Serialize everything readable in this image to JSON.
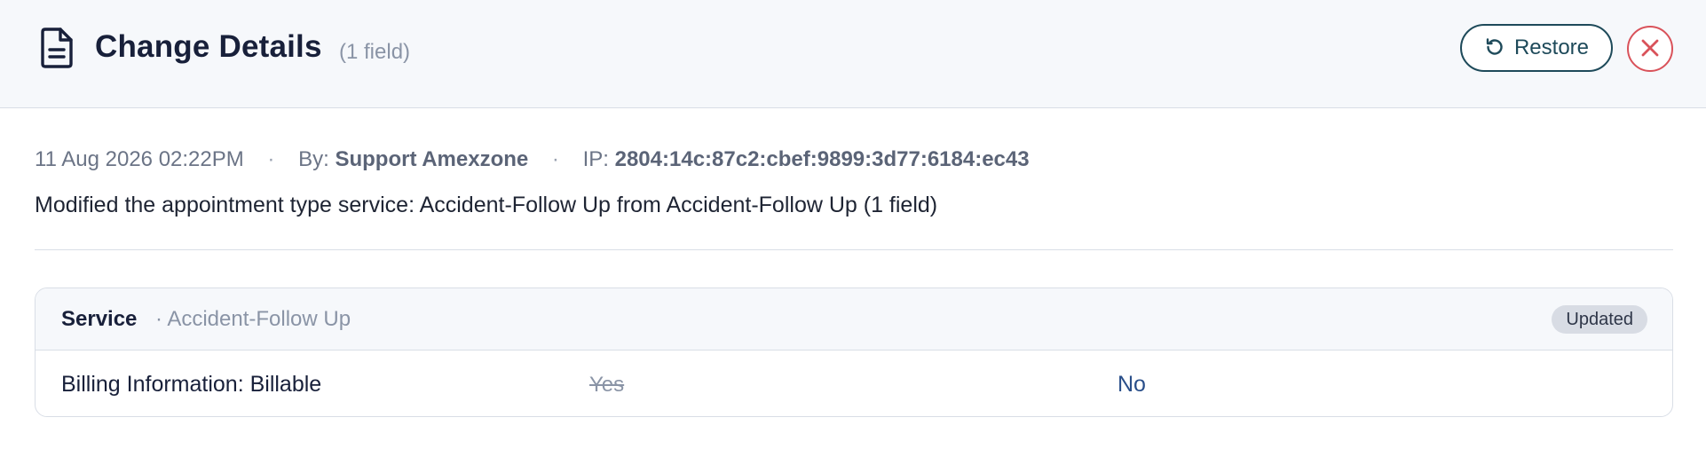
{
  "header": {
    "title": "Change Details",
    "field_count": "(1 field)",
    "restore_label": "Restore",
    "icons": [
      "document-icon",
      "restore-icon",
      "close-icon"
    ]
  },
  "meta": {
    "timestamp": "11 Aug 2026 02:22PM",
    "separator": "·",
    "by_prefix": "By:",
    "by_value": "Support Amexzone",
    "ip_prefix": "IP:",
    "ip_value": "2804:14c:87c2:cbef:9899:3d77:6184:ec43"
  },
  "description": "Modified the appointment type service: Accident-Follow Up from Accident-Follow Up (1 field)",
  "change_card": {
    "entity": "Service",
    "entity_sub": "· Accident-Follow Up",
    "badge": "Updated",
    "rows": [
      {
        "field": "Billing Information: Billable",
        "old_value": "Yes",
        "new_value": "No"
      }
    ]
  },
  "colors": {
    "header_bg": "#f6f8fb",
    "restore_border": "#1e4a5a",
    "close_accent": "#d9525a",
    "new_value": "#2a4f8a",
    "badge_bg": "#d8dce4"
  }
}
